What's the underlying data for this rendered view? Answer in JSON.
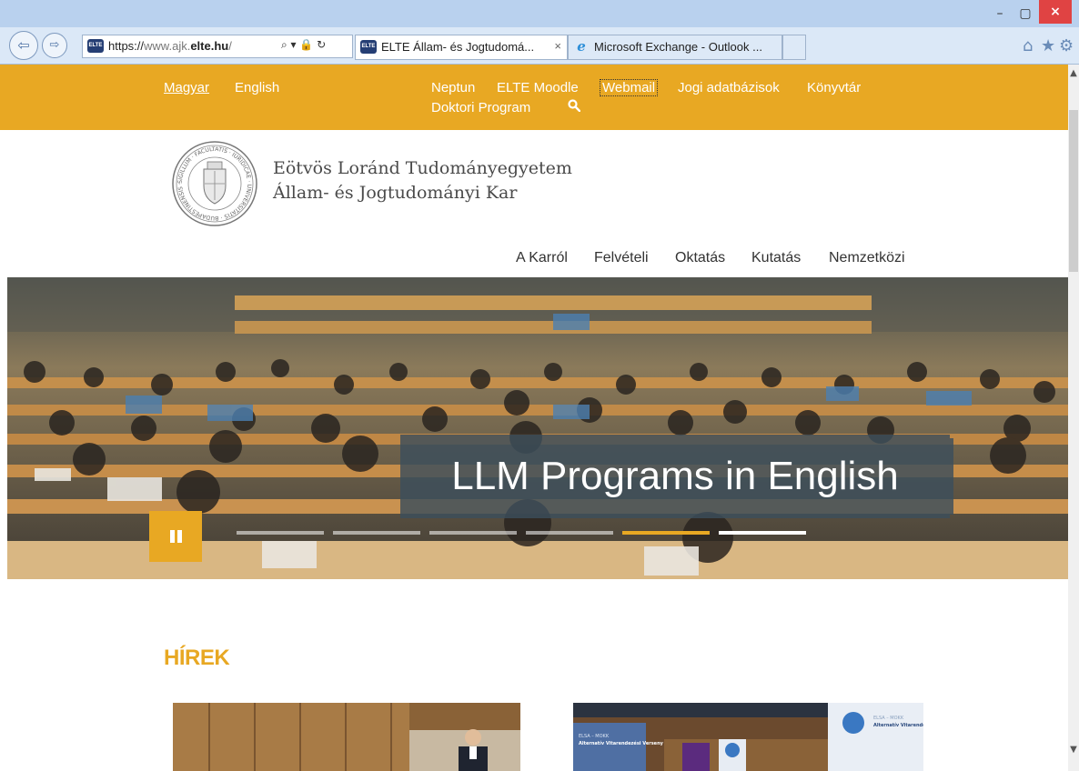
{
  "browser": {
    "window_controls": {
      "minimize": "–",
      "maximize": "▢",
      "close": "×"
    },
    "nav": {
      "back": "⇦",
      "forward": "⇨"
    },
    "address_prefix": "https://",
    "address_host": "www.ajk.",
    "address_domain": "elte.hu",
    "address_path": "/",
    "address_icons": "⌕ ▾ 🔒 ↻",
    "tabs": [
      {
        "title": "ELTE Állam- és Jogtudomá...",
        "close": "×",
        "favicon": "ELTE"
      },
      {
        "title": "Microsoft Exchange - Outlook ...",
        "favicon": "e"
      }
    ],
    "toolbar_icons": {
      "home": "⌂",
      "favorites": "★",
      "settings": "⚙"
    }
  },
  "topbar": {
    "lang_active": "Magyar",
    "lang_other": "English",
    "links": [
      "Neptun",
      "ELTE Moodle",
      "Webmail",
      "Jogi adatbázisok",
      "Könyvtár",
      "Doktori Program"
    ],
    "accent": "#e8a823"
  },
  "header": {
    "uni_line1": "Eötvös Loránd Tudományegyetem",
    "uni_line2": "Állam- és Jogtudományi Kar",
    "seal_ring_text": "SIGILLUM · FACULTATIS · IURIDICAE · UNIVERSITATIS · BUDAPESTINENSIS ·"
  },
  "main_nav": [
    "A Karról",
    "Felvételi",
    "Oktatás",
    "Kutatás",
    "Nemzetközi"
  ],
  "hero": {
    "caption": "LLM Programs in English",
    "slide_count": 6,
    "active_slide": 5
  },
  "news": {
    "heading": "HÍREK",
    "thumb2_labels": [
      "ELSA – MOKK",
      "Alternatív Vitarendezési Verseny"
    ]
  },
  "scrollbar": {
    "up": "▲",
    "down": "▼"
  }
}
